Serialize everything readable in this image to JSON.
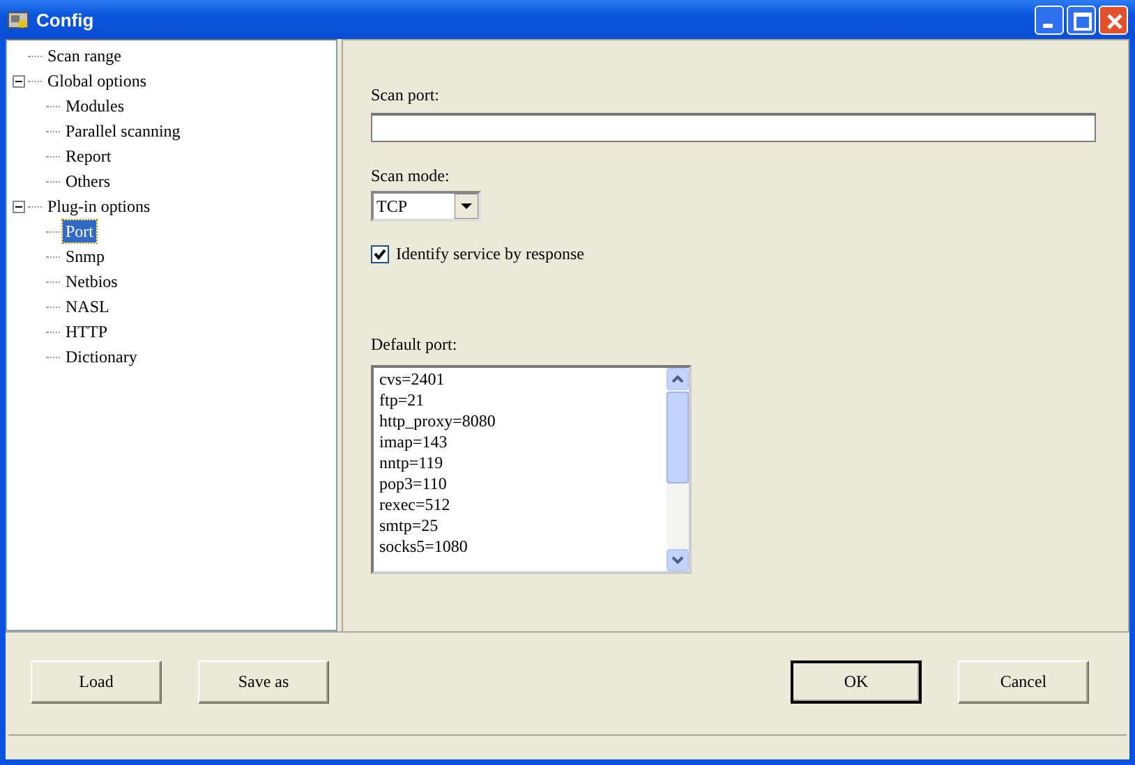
{
  "window": {
    "title": "Config"
  },
  "tree": [
    {
      "label": "Scan range",
      "selected": false
    },
    {
      "label": "Global options",
      "selected": false,
      "expanded": true,
      "children": [
        {
          "label": "Modules",
          "selected": false
        },
        {
          "label": "Parallel scanning",
          "selected": false
        },
        {
          "label": "Report",
          "selected": false
        },
        {
          "label": "Others",
          "selected": false
        }
      ]
    },
    {
      "label": "Plug-in options",
      "selected": false,
      "expanded": true,
      "children": [
        {
          "label": "Port",
          "selected": true
        },
        {
          "label": "Snmp",
          "selected": false
        },
        {
          "label": "Netbios",
          "selected": false
        },
        {
          "label": "NASL",
          "selected": false
        },
        {
          "label": "HTTP",
          "selected": false
        },
        {
          "label": "Dictionary",
          "selected": false
        }
      ]
    }
  ],
  "scan_port": {
    "label": "Scan port:"
  },
  "scan_mode": {
    "label": "Scan mode:",
    "value": "TCP"
  },
  "identify": {
    "label": "Identify service by response",
    "checked": true
  },
  "default_port": {
    "label": "Default port:",
    "lines": [
      "cvs=2401",
      "ftp=21",
      "http_proxy=8080",
      "imap=143",
      "nntp=119",
      "pop3=110",
      "rexec=512",
      "smtp=25",
      "socks5=1080"
    ]
  },
  "buttons": [
    {
      "label": "Load",
      "kind": "normal"
    },
    {
      "label": "Save as",
      "kind": "normal"
    },
    {
      "label": "OK",
      "kind": "default"
    },
    {
      "label": "Cancel",
      "kind": "normal"
    }
  ]
}
